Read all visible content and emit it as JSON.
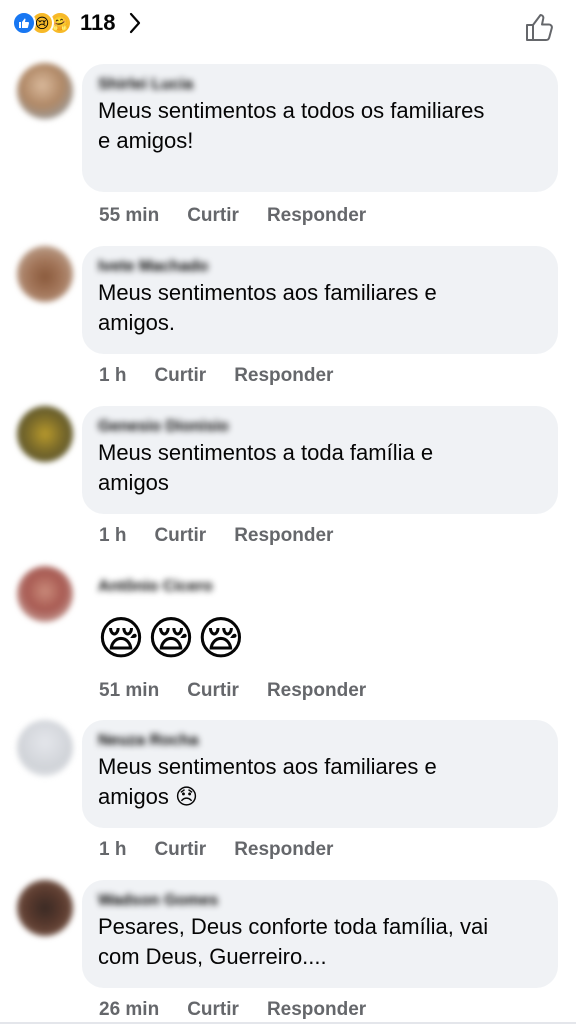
{
  "header": {
    "reaction_count": "118",
    "reactions": [
      "like-icon",
      "sad-icon",
      "care-icon"
    ]
  },
  "comments": [
    {
      "name": "Shirlei Lucia",
      "text": "Meus sentimentos a todos os familiares\ne amigos!",
      "time": "55 min",
      "like_label": "Curtir",
      "reply_label": "Responder"
    },
    {
      "name": "Ivete Machado",
      "text": "Meus sentimentos aos familiares e\namigos.",
      "time": "1 h",
      "like_label": "Curtir",
      "reply_label": "Responder"
    },
    {
      "name": "Genesio Dionisio",
      "text": "Meus sentimentos a toda família e\namigos",
      "time": "1 h",
      "like_label": "Curtir",
      "reply_label": "Responder"
    },
    {
      "name": "Antônio Cicero",
      "text": "😪😪😪",
      "time": "51 min",
      "like_label": "Curtir",
      "reply_label": "Responder"
    },
    {
      "name": "Neuza Rocha",
      "text": "Meus sentimentos aos familiares e\namigos 😞",
      "time": "1 h",
      "like_label": "Curtir",
      "reply_label": "Responder"
    },
    {
      "name": "Wadson Gomes",
      "text": "Pesares, Deus conforte toda família, vai\ncom Deus, Guerreiro....",
      "time": "26 min",
      "like_label": "Curtir",
      "reply_label": "Responder"
    }
  ],
  "colors": {
    "bubble": "#f0f2f5",
    "meta_text": "#65676b",
    "like_blue": "#1877f2",
    "emoji_yellow": "#f7b928"
  }
}
